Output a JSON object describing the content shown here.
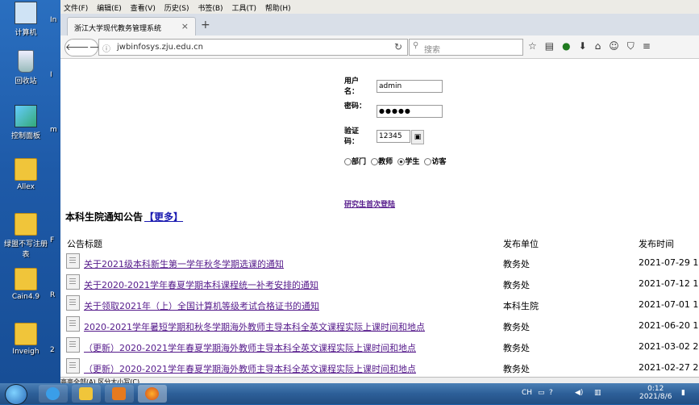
{
  "desktop": {
    "icons": [
      {
        "label": "计算机",
        "icon": "computer-icon"
      },
      {
        "label": "回收站",
        "icon": "recycle-bin-icon"
      },
      {
        "label": "控制面板",
        "icon": "control-panel-icon"
      },
      {
        "label": "Allex",
        "icon": "folder-icon"
      },
      {
        "label": "绿盟不写注册表",
        "icon": "folder-icon"
      },
      {
        "label": "Cain4.9",
        "icon": "folder-icon"
      },
      {
        "label": "Inveigh",
        "icon": "folder-icon"
      }
    ],
    "side_labels": [
      "In",
      "I",
      "m",
      "F",
      "R",
      "2"
    ]
  },
  "browser": {
    "menu": [
      "文件(F)",
      "编辑(E)",
      "查看(V)",
      "历史(S)",
      "书签(B)",
      "工具(T)",
      "帮助(H)"
    ],
    "tab_title": "浙江大学现代教务管理系统",
    "url": "jwbinfosys.zju.edu.cn",
    "search_placeholder": "搜索",
    "toolbar_icons": [
      "star-icon",
      "reader-icon",
      "pocket-icon",
      "download-icon",
      "home-icon",
      "chat-icon",
      "shield-icon",
      "menu-icon"
    ]
  },
  "login": {
    "username_label": "用户名：",
    "username_value": "admin",
    "password_label": "密码：",
    "password_value": "●●●●●",
    "captcha_label": "验证码：",
    "captcha_value": "12345",
    "roles": [
      {
        "label": "部门",
        "selected": false
      },
      {
        "label": "教师",
        "selected": false
      },
      {
        "label": "学生",
        "selected": true
      },
      {
        "label": "访客",
        "selected": false
      }
    ],
    "grad_link": "研究生首次登陆"
  },
  "notices": {
    "heading": "本科生院通知公告",
    "more": "【更多】",
    "columns": [
      "公告标题",
      "发布单位",
      "发布时间"
    ],
    "rows": [
      {
        "title": "关于2021级本科新生第一学年秋冬学期选课的通知",
        "unit": "教务处",
        "date": "2021-07-29 12"
      },
      {
        "title": "关于2020-2021学年春夏学期本科课程统一补考安排的通知",
        "unit": "教务处",
        "date": "2021-07-12 10"
      },
      {
        "title": "关于领取2021年（上）全国计算机等级考试合格证书的通知",
        "unit": "本科生院",
        "date": "2021-07-01 12"
      },
      {
        "title": "2020-2021学年暑短学期和秋冬学期海外教师主导本科全英文课程实际上课时间和地点",
        "unit": "教务处",
        "date": "2021-06-20 19"
      },
      {
        "title": "（更新）2020-2021学年春夏学期海外教师主导本科全英文课程实际上课时间和地点",
        "unit": "教务处",
        "date": "2021-03-02 20"
      },
      {
        "title": "（更新）2020-2021学年春夏学期海外教师主导本科全英文课程实际上课时间和地点",
        "unit": "教务处",
        "date": "2021-02-27 22"
      }
    ],
    "findbar": "高亮全部(A)   区分大小写(C)"
  },
  "taskbar": {
    "time": "0:12",
    "date": "2021/8/6",
    "tray_label": "CH"
  }
}
